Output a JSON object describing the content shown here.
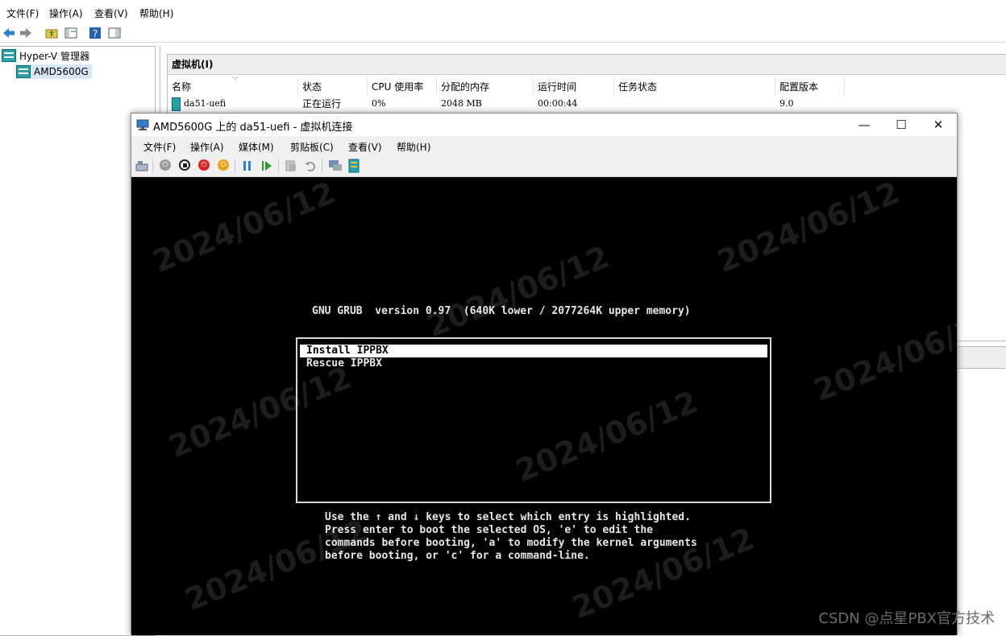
{
  "hyperv": {
    "menu": [
      "文件(F)",
      "操作(A)",
      "查看(V)",
      "帮助(H)"
    ],
    "tree": {
      "root": "Hyper-V 管理器",
      "server": "AMD5600G"
    },
    "vm_panel_title": "虚拟机(I)",
    "columns": [
      "名称",
      "状态",
      "CPU 使用率",
      "分配的内存",
      "运行时间",
      "任务状态",
      "配置版本"
    ],
    "vm_row": {
      "name": "da51-uefi",
      "state": "正在运行",
      "cpu": "0%",
      "memory": "2048 MB",
      "uptime": "00:00:44",
      "task": "",
      "version": "9.0"
    }
  },
  "vmconnect": {
    "title": "AMD5600G 上的 da51-uefi - 虚拟机连接",
    "menu": [
      "文件(F)",
      "操作(A)",
      "媒体(M)",
      "剪贴板(C)",
      "查看(V)",
      "帮助(H)"
    ],
    "window_controls": {
      "minimize": "—",
      "maximize": "☐",
      "close": "✕"
    }
  },
  "grub": {
    "header": "GNU GRUB  version 0.97  (640K lower / 2077264K upper memory)",
    "entries": [
      "Install IPPBX",
      "Rescue IPPBX"
    ],
    "selected_index": 0,
    "help": [
      "Use the ↑ and ↓ keys to select which entry is highlighted.",
      "Press enter to boot the selected OS, 'e' to edit the",
      "commands before booting, 'a' to modify the kernel arguments",
      "before booting, or 'c' for a command-line."
    ]
  },
  "watermark": "CSDN @点星PBX官方技术",
  "colors": {
    "console_bg": "#000000",
    "console_fg": "#e8e8e8",
    "selection_bg": "#ffffff"
  }
}
